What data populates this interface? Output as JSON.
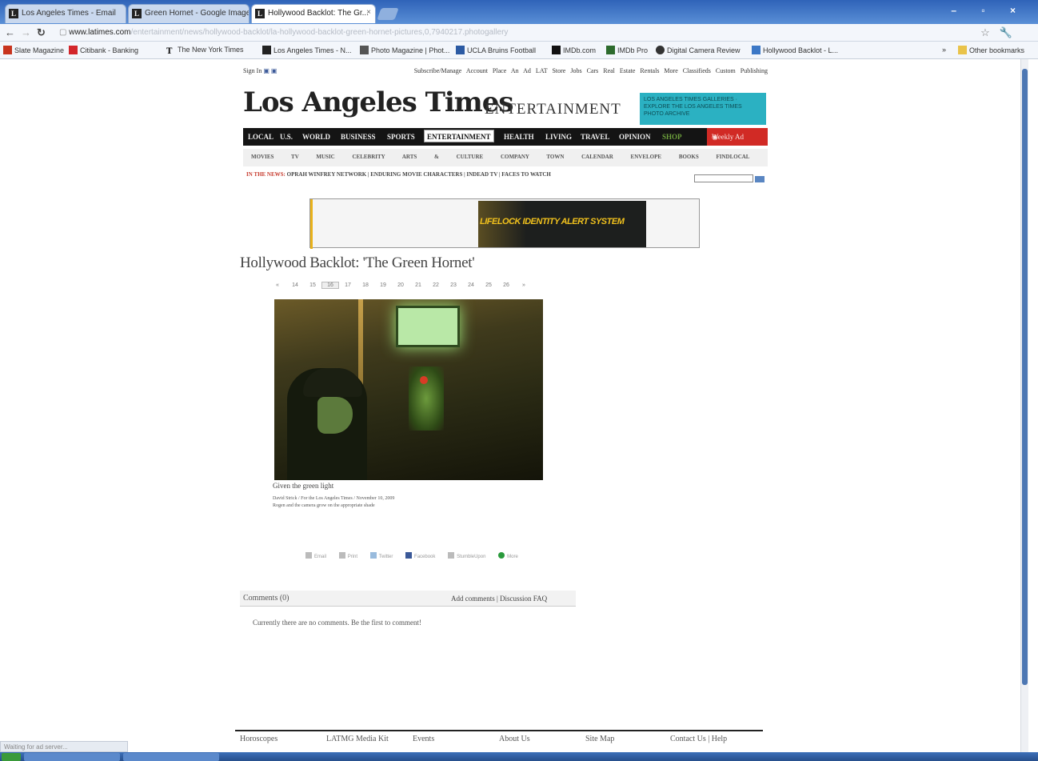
{
  "browser": {
    "tabs": [
      {
        "label": "Los Angeles Times - Email",
        "active": false
      },
      {
        "label": "Green Hornet - Google Images",
        "active": false
      },
      {
        "label": "Hollywood Backlot: The Gr...",
        "active": true
      }
    ],
    "window_controls": "– ▫ ×",
    "url_host": "www.latimes.com",
    "url_rest": "/entertainment/news/hollywood-backlot/la-hollywood-backlot-green-hornet-pictures,0,7940217.photogallery",
    "bookmarks": [
      "Slate Magazine",
      "Citibank - Banking",
      "The New York Times",
      "Los Angeles Times - N...",
      "Photo Magazine | Phot...",
      "UCLA Bruins Football",
      "IMDb.com",
      "IMDb Pro",
      "Digital Camera Review",
      "Hollywood Backlot - L..."
    ],
    "other_bookmarks": "Other bookmarks",
    "status": "Waiting for ad server..."
  },
  "site": {
    "util_left": "Sign In",
    "util_right": "Subscribe/Manage Account   Place An Ad   LAT Store   Jobs   Cars   Real Estate   Rentals   More Classifieds   Custom Publishing",
    "masthead": "Los Angeles Times",
    "section": "ENTERTAINMENT",
    "promo": "LOS ANGELES TIMES GALLERIES · EXPLORE THE LOS ANGELES TIMES PHOTO ARCHIVE",
    "main_nav": [
      "LOCAL",
      "U.S.",
      "WORLD",
      "BUSINESS",
      "SPORTS",
      "ENTERTAINMENT",
      "HEALTH",
      "LIVING",
      "TRAVEL",
      "OPINION",
      "SHOP"
    ],
    "weekly_ad": "Weekly Ad",
    "sub_nav": [
      "MOVIES",
      "TV",
      "MUSIC",
      "CELEBRITY",
      "ARTS & CULTURE",
      "COMPANY TOWN",
      "CALENDAR",
      "ENVELOPE",
      "BOOKS",
      "FINDLOCAL"
    ],
    "in_the_news_label": "IN THE NEWS:",
    "in_the_news": "OPRAH WINFREY NETWORK  |  ENDURING MOVIE CHARACTERS  |  INDEAD TV  |  FACES TO WATCH",
    "ad_text": "LIFELOCK IDENTITY ALERT SYSTEM"
  },
  "gallery": {
    "headline": "Hollywood Backlot: 'The Green Hornet'",
    "pager": [
      "«",
      "14",
      "15",
      "16",
      "17",
      "18",
      "19",
      "20",
      "21",
      "22",
      "23",
      "24",
      "25",
      "26",
      "»"
    ],
    "current_page": "16",
    "caption": "Given the green light",
    "credit_line1": "David Strick / For the Los Angeles Times / November 10, 2009",
    "credit_line2": "Rogen and the camera grow on the appropriate shade",
    "share": [
      "Email",
      "Print",
      "Twitter",
      "Facebook",
      "StumbleUpon",
      "More"
    ]
  },
  "comments": {
    "title": "Comments (0)",
    "links": "Add comments | Discussion FAQ",
    "empty": "Currently there are no comments. Be the first to comment!"
  },
  "footer": [
    "Horoscopes",
    "LATMG Media Kit",
    "Events",
    "About Us",
    "Site Map",
    "Contact Us | Help"
  ]
}
